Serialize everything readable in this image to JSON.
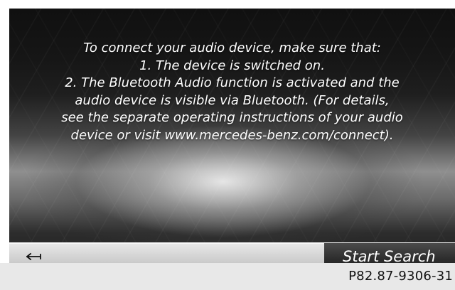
{
  "screen": {
    "message_lines": [
      "To connect your audio device, make sure that:",
      "1. The device is switched on.",
      "2. The Bluetooth Audio function is activated and the",
      "audio device is visible via Bluetooth. (For details,",
      "see the separate operating instructions of your audio",
      "device or visit www.mercedes-benz.com/connect)."
    ]
  },
  "bottom_bar": {
    "back_icon": "return-arrow-icon",
    "start_search_label": "Start Search"
  },
  "caption": {
    "reference_code": "P82.87-9306-31"
  },
  "colors": {
    "screen_background": "#1f1f1f",
    "text": "#ffffff",
    "active_button": "#2f2f2f",
    "bar_button": "#d3d3d3",
    "caption_background": "#e8e8e8"
  }
}
